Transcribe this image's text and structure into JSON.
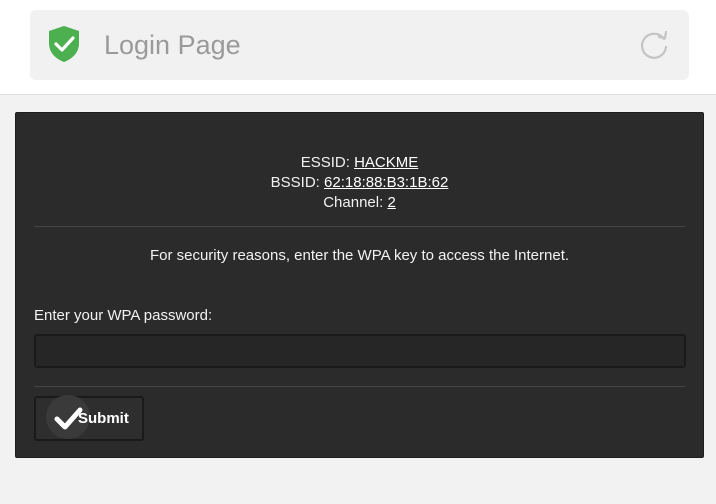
{
  "header": {
    "title": "Login Page",
    "shield_icon": "shield-check-icon",
    "reload_icon": "reload-icon",
    "shield_color": "#4caf50"
  },
  "network": {
    "essid_label": "ESSID:",
    "essid_value": "HACKME",
    "bssid_label": "BSSID:",
    "bssid_value": "62:18:88:B3:1B:62",
    "channel_label": "Channel:",
    "channel_value": "2"
  },
  "form": {
    "security_message": "For security reasons, enter the WPA key to access the Internet.",
    "password_label": "Enter your WPA password:",
    "password_value": "",
    "submit_label": "Submit",
    "submit_icon": "checkmark-icon"
  }
}
